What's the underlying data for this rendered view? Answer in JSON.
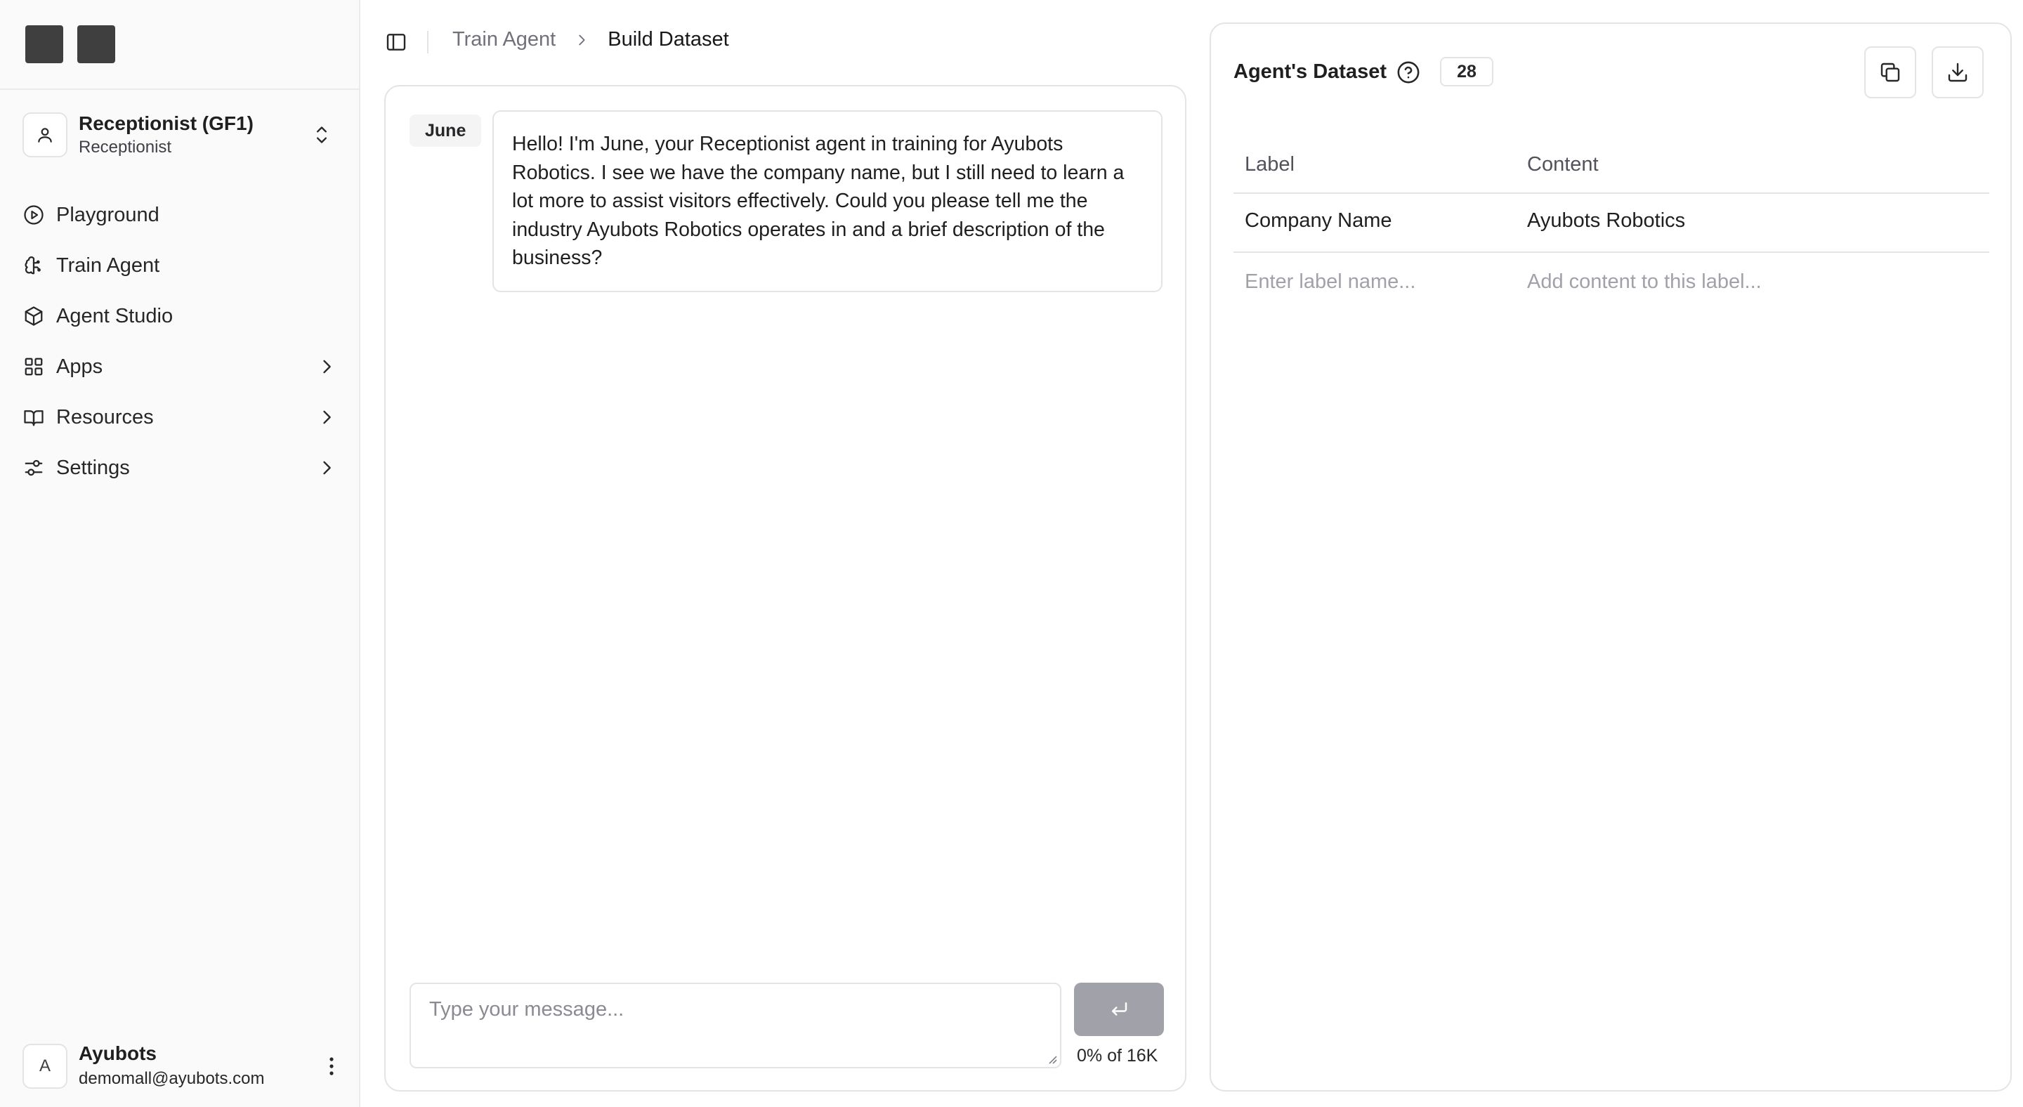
{
  "sidebar": {
    "agent": {
      "name": "Receptionist (GF1)",
      "role": "Receptionist"
    },
    "nav": [
      {
        "label": "Playground",
        "icon": "play-circle-icon"
      },
      {
        "label": "Train Agent",
        "icon": "brain-icon"
      },
      {
        "label": "Agent Studio",
        "icon": "cube-icon"
      },
      {
        "label": "Apps",
        "icon": "grid-icon",
        "expandable": true
      },
      {
        "label": "Resources",
        "icon": "book-icon",
        "expandable": true
      },
      {
        "label": "Settings",
        "icon": "sliders-icon",
        "expandable": true
      }
    ],
    "user": {
      "initial": "A",
      "name": "Ayubots",
      "email": "demomall@ayubots.com"
    }
  },
  "breadcrumb": {
    "parent": "Train Agent",
    "current": "Build Dataset"
  },
  "chat": {
    "sender": "June",
    "message": "Hello! I'm June, your Receptionist agent in training for Ayubots Robotics. I see we have the company name, but I still need to learn a lot more to assist visitors effectively. Could you please tell me the industry Ayubots Robotics operates in and a brief description of the business?",
    "input_placeholder": "Type your message...",
    "usage": "0% of 16K"
  },
  "dataset": {
    "title": "Agent's Dataset",
    "count": "28",
    "columns": {
      "label": "Label",
      "content": "Content"
    },
    "rows": [
      {
        "label": "Company Name",
        "content": "Ayubots Robotics"
      }
    ],
    "new_label_placeholder": "Enter label name...",
    "new_content_placeholder": "Add content to this label..."
  },
  "colors": {
    "sidebar_bg": "#fafafa",
    "border": "#e4e4e7",
    "send_button": "#a1a1aa",
    "text": "#18181b",
    "muted": "#71717a"
  }
}
